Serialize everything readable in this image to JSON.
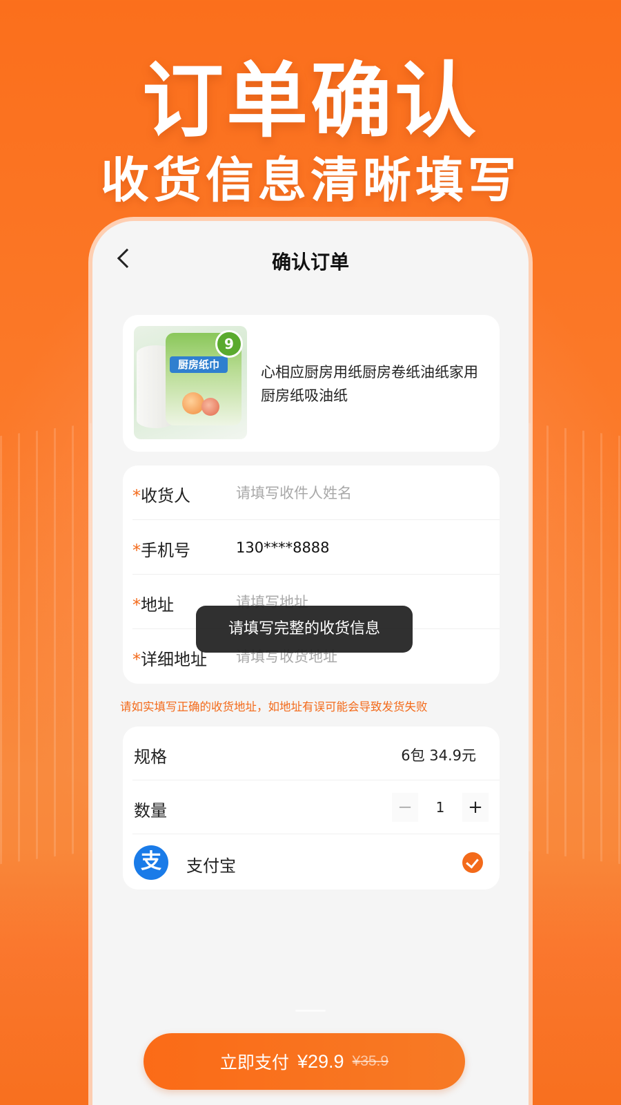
{
  "hero": {
    "title": "订单确认",
    "subtitle": "收货信息清晰填写"
  },
  "nav": {
    "title": "确认订单",
    "back_icon": "chevron-left-icon"
  },
  "product": {
    "title": "心相应厨房用纸厨房卷纸油纸家用厨房纸吸油纸",
    "image_label": "厨房纸巾",
    "image_badge": "9"
  },
  "form": {
    "required_mark": "*",
    "receiver_label": "收货人",
    "receiver_placeholder": "请填写收件人姓名",
    "receiver_value": "",
    "phone_label": "手机号",
    "phone_value": "130****8888",
    "address_label": "地址",
    "address_placeholder": "请填写地址",
    "address_value": "",
    "detail_label": "详细地址",
    "detail_placeholder": "请填写收货地址",
    "detail_value": ""
  },
  "toast": {
    "message": "请填写完整的收货信息"
  },
  "notice": "请如实填写正确的收货地址，如地址有误可能会导致发货失败",
  "options": {
    "spec_label": "规格",
    "spec_value": "6包 34.9元",
    "quantity_label": "数量",
    "quantity_value": "1",
    "minus": "−",
    "plus": "+",
    "payment_label": "支付宝",
    "payment_icon_glyph": "支",
    "payment_selected": true
  },
  "pay_button": {
    "label": "立即支付",
    "price": "¥29.9",
    "original_price": "¥35.9"
  },
  "colors": {
    "accent": "#f36a1a",
    "background": "#fb6f1c",
    "alipay": "#1a7be8"
  }
}
